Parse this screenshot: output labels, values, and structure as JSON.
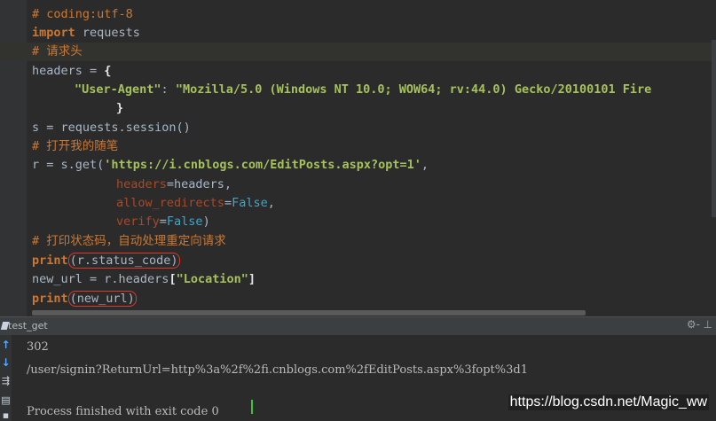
{
  "code": {
    "l1": "# coding:utf-8",
    "l2_kw": "import",
    "l2_mod": " requests",
    "l3": "# 请求头",
    "l4_a": "headers = ",
    "l4_b": "{",
    "l5_key": "\"User-Agent\"",
    "l5_colon": ": ",
    "l5_val": "\"Mozilla/5.0 (Windows NT 10.0; WOW64; rv:44.0) Gecko/20100101 Fire",
    "l6": "}",
    "l7": "s = requests.session()",
    "l8": "# 打开我的随笔",
    "l9_a": "r = s.get(",
    "l9_url": "'https://i.cnblogs.com/EditPosts.aspx?opt=1'",
    "l9_b": ",",
    "l10_attr": "headers",
    "l10_rest": "=headers,",
    "l11_attr": "allow_redirects",
    "l11_eq": "=",
    "l11_val": "False",
    "l11_b": ",",
    "l12_attr": "verify",
    "l12_eq": "=",
    "l12_val": "False",
    "l12_b": ")",
    "l13": "# 打印状态码，自动处理重定向请求",
    "l14_kw": "print",
    "l14_arg": "(r.status_code)",
    "l15_a": "new_url = r.headers",
    "l15_lb": "[",
    "l15_str": "\"Location\"",
    "l15_rb": "]",
    "l16_kw": "print",
    "l16_arg": "(new_url)"
  },
  "run_panel": {
    "tab_label": "test_get",
    "settings_icon": "⚙-",
    "pin_icon": "⊥"
  },
  "console": {
    "line1": "302",
    "line2": "/user/signin?ReturnUrl=http%3a%2f%2fi.cnblogs.com%2fEditPosts.aspx%3fopt%3d1",
    "line3": "Process finished with exit code 0"
  },
  "watermark": "https://blog.csdn.net/Magic_ww",
  "colors": {
    "background": "#2b2b2b",
    "keyword": "#cc7832",
    "string": "#a5c25c",
    "param": "#aa4926",
    "boolean": "#3ea7c7",
    "annotation_red": "#e0392c"
  }
}
